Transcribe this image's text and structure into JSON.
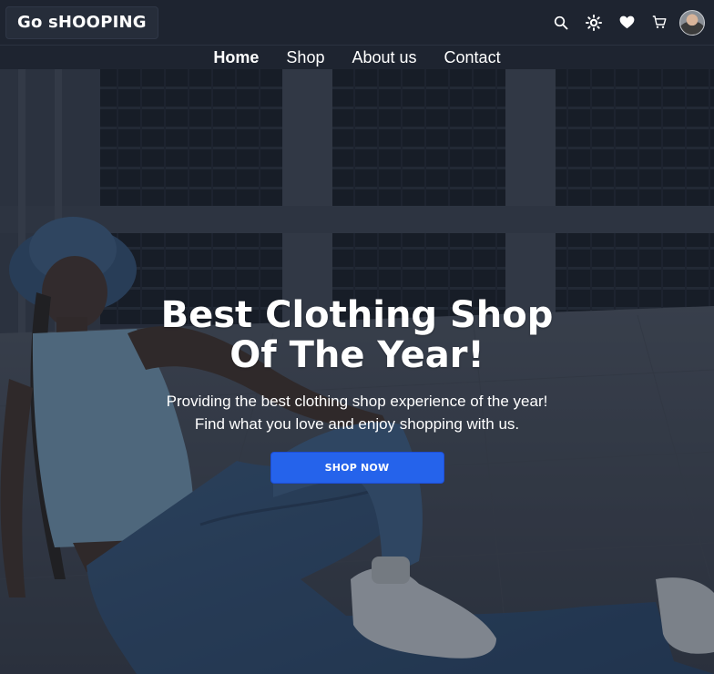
{
  "brand": {
    "logo_text": "Go sHOOPING"
  },
  "header_icons": [
    "search-icon",
    "sun-icon",
    "heart-icon",
    "cart-icon"
  ],
  "nav": {
    "items": [
      {
        "label": "Home",
        "active": true
      },
      {
        "label": "Shop",
        "active": false
      },
      {
        "label": "About us",
        "active": false
      },
      {
        "label": "Contact",
        "active": false
      }
    ]
  },
  "hero": {
    "title_line1": "Best Clothing Shop",
    "title_line2": "Of The Year!",
    "subtitle": "Providing the best clothing shop experience of the year! Find what you love and enjoy shopping with us.",
    "cta_label": "SHOP NOW"
  },
  "colors": {
    "background": "#1e2430",
    "accent": "#2563eb",
    "text": "#ffffff"
  }
}
